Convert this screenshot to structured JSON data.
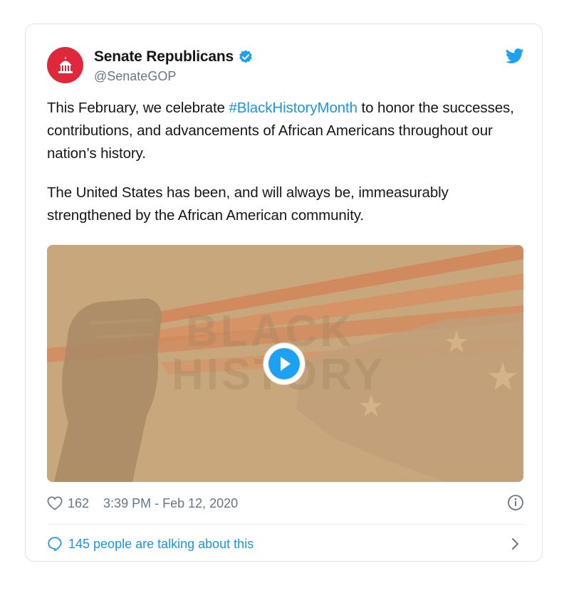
{
  "account": {
    "name": "Senate Republicans",
    "handle": "@SenateGOP",
    "verified": true,
    "avatar_color": "#e0283d"
  },
  "tweet": {
    "paragraph1_before": "This February, we celebrate ",
    "hashtag": "#BlackHistoryMonth",
    "paragraph1_after": " to honor the successes, contributions, and advancements of African Americans throughout our nation’s history.",
    "paragraph2": "The United States has been, and will always be, immeasurably strengthened by the African American community."
  },
  "media": {
    "overlay_line1": "BLACK",
    "overlay_line2": "HISTORY",
    "play_icon": "play-icon"
  },
  "footer": {
    "like_count": "162",
    "timestamp": "3:39 PM - Feb 12, 2020",
    "talking": "145 people are talking about this"
  },
  "colors": {
    "link": "#1b95e0",
    "muted": "#657786",
    "twitter_blue": "#1da1f2",
    "border": "#dfe4e8"
  }
}
